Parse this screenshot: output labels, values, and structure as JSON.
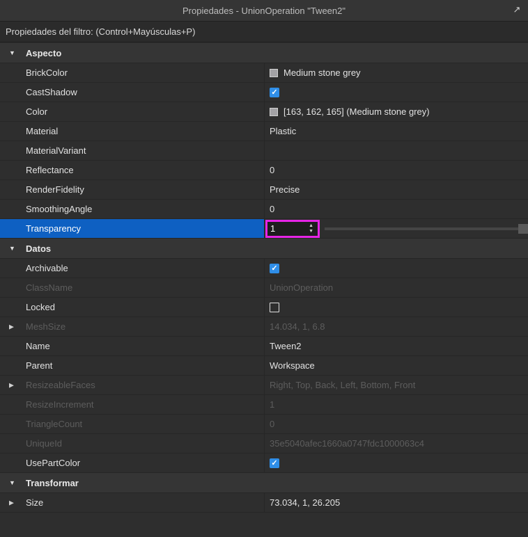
{
  "window": {
    "title": "Propiedades - UnionOperation \"Tween2\"",
    "popout_icon": "popout-icon"
  },
  "filter": {
    "placeholder": "Propiedades del filtro: (Control+Mayúsculas+P)"
  },
  "sections": {
    "aspecto": {
      "label": "Aspecto",
      "rows": {
        "brickcolor": {
          "name": "BrickColor",
          "value": "Medium stone grey"
        },
        "castshadow": {
          "name": "CastShadow",
          "checked": true
        },
        "color": {
          "name": "Color",
          "value": "[163, 162, 165] (Medium stone grey)"
        },
        "material": {
          "name": "Material",
          "value": "Plastic"
        },
        "materialvariant": {
          "name": "MaterialVariant",
          "value": ""
        },
        "reflectance": {
          "name": "Reflectance",
          "value": "0"
        },
        "renderfidelity": {
          "name": "RenderFidelity",
          "value": "Precise"
        },
        "smoothingangle": {
          "name": "SmoothingAngle",
          "value": "0"
        },
        "transparency": {
          "name": "Transparency",
          "value": "1",
          "slider_level": 1.0
        }
      }
    },
    "datos": {
      "label": "Datos",
      "rows": {
        "archivable": {
          "name": "Archivable",
          "checked": true
        },
        "classname": {
          "name": "ClassName",
          "value": "UnionOperation"
        },
        "locked": {
          "name": "Locked",
          "checked": false
        },
        "meshsize": {
          "name": "MeshSize",
          "value": "14.034, 1, 6.8"
        },
        "name": {
          "name": "Name",
          "value": "Tween2"
        },
        "parent": {
          "name": "Parent",
          "value": "Workspace"
        },
        "resizeablefaces": {
          "name": "ResizeableFaces",
          "value": "Right, Top, Back, Left, Bottom, Front"
        },
        "resizeincrement": {
          "name": "ResizeIncrement",
          "value": "1"
        },
        "trianglecount": {
          "name": "TriangleCount",
          "value": "0"
        },
        "uniqueid": {
          "name": "UniqueId",
          "value": "35e5040afec1660a0747fdc1000063c4"
        },
        "usepartcolor": {
          "name": "UsePartColor",
          "checked": true
        }
      }
    },
    "transformar": {
      "label": "Transformar",
      "rows": {
        "size": {
          "name": "Size",
          "value": "73.034, 1, 26.205"
        }
      }
    }
  },
  "colors": {
    "background": "#2e2e2e",
    "selection": "#0e60c2",
    "checkbox_on": "#2f8ee8",
    "highlight_box": "#e524e5",
    "swatch": "#a3a2a5"
  }
}
